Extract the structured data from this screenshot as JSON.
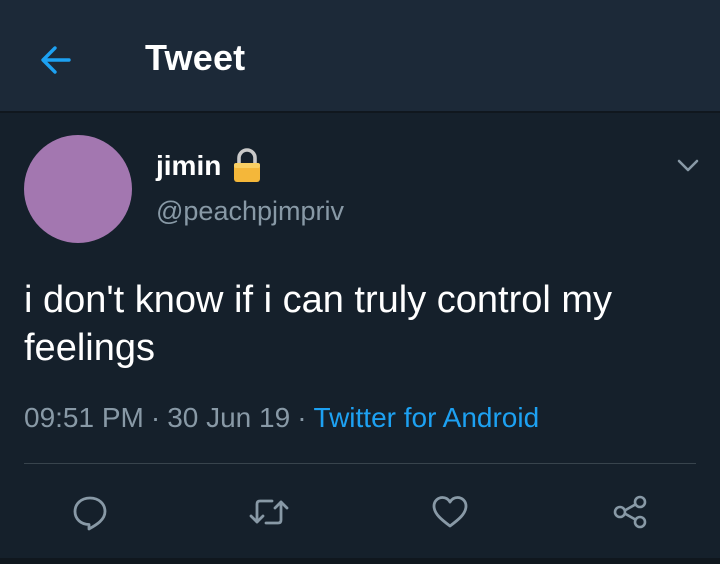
{
  "header": {
    "title": "Tweet",
    "back_icon": "arrow-left-icon"
  },
  "tweet": {
    "author": {
      "display_name": "jimin",
      "handle": "@peachpjmpriv",
      "protected_icon": "lock-icon",
      "avatar_color": "#a377b0"
    },
    "text": "i don't know if i can truly control my feelings",
    "time": "09:51 PM",
    "separator": "·",
    "date": "30 Jun 19",
    "source": "Twitter for Android",
    "menu_icon": "chevron-down-icon"
  },
  "actions": [
    {
      "name": "reply",
      "icon": "comment-icon"
    },
    {
      "name": "retweet",
      "icon": "retweet-icon"
    },
    {
      "name": "like",
      "icon": "heart-icon"
    },
    {
      "name": "share",
      "icon": "share-icon"
    }
  ],
  "colors": {
    "background": "#15202b",
    "header_background": "#1c2938",
    "accent": "#1da1f2",
    "secondary_text": "#8899a6",
    "icon": "#8899a6"
  }
}
